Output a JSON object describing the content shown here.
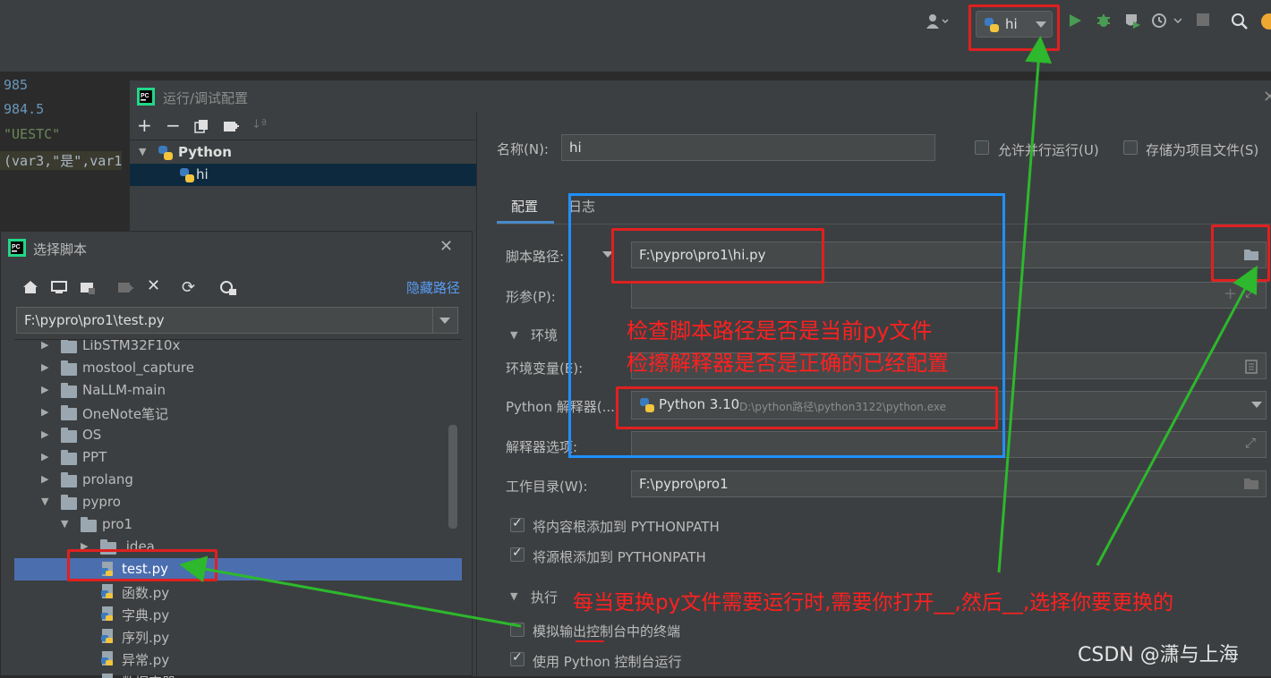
{
  "toolbar": {
    "run_config_name": "hi"
  },
  "editor": {
    "lines": [
      "985",
      "984.5",
      "\"UESTC\"",
      "(var3,\"是\",var1"
    ]
  },
  "run_debug_dialog": {
    "title": "运行/调试配置",
    "tree": {
      "group": "Python",
      "item": "hi"
    },
    "name_label": "名称(N):",
    "name_value": "hi",
    "allow_parallel_label": "允许并行运行(U)",
    "store_as_project_file_label": "存储为项目文件(S)",
    "tabs": [
      "配置",
      "日志"
    ],
    "script_path_label": "脚本路径:",
    "script_path_value": "F:\\pypro\\pro1\\hi.py",
    "params_label": "形参(P):",
    "env_section": "环境",
    "env_vars_label": "环境变量(E):",
    "interpreter_label": "Python 解释器(...",
    "interpreter_name": "Python 3.10",
    "interpreter_path": "D:\\python路径\\python3122\\python.exe",
    "interpreter_options_label": "解释器选项:",
    "workdir_label": "工作目录(W):",
    "workdir_value": "F:\\pypro\\pro1",
    "add_content_roots_label": "将内容根添加到 PYTHONPATH",
    "add_source_roots_label": "将源根添加到 PYTHONPATH",
    "exec_section": "执行",
    "emulate_terminal_label": "模拟输出控制台中的终端",
    "use_python_console_label": "使用 Python 控制台运行"
  },
  "choose_script_dialog": {
    "title": "选择脚本",
    "hide_path_label": "隐藏路径",
    "path_value": "F:\\pypro\\pro1\\test.py",
    "tree": [
      {
        "label": "LibSTM32F10x",
        "type": "folder",
        "indent": 0,
        "expanded": false
      },
      {
        "label": "mostool_capture",
        "type": "folder",
        "indent": 0,
        "expanded": false
      },
      {
        "label": "NaLLM-main",
        "type": "folder",
        "indent": 0,
        "expanded": false
      },
      {
        "label": "OneNote笔记",
        "type": "folder",
        "indent": 0,
        "expanded": false
      },
      {
        "label": "OS",
        "type": "folder",
        "indent": 0,
        "expanded": false
      },
      {
        "label": "PPT",
        "type": "folder",
        "indent": 0,
        "expanded": false
      },
      {
        "label": "prolang",
        "type": "folder",
        "indent": 0,
        "expanded": false
      },
      {
        "label": "pypro",
        "type": "folder",
        "indent": 0,
        "expanded": true
      },
      {
        "label": "pro1",
        "type": "folder",
        "indent": 1,
        "expanded": true
      },
      {
        "label": ".idea",
        "type": "folder",
        "indent": 2,
        "expanded": false
      },
      {
        "label": "test.py",
        "type": "py",
        "indent": 2,
        "selected": true
      },
      {
        "label": "函数.py",
        "type": "py",
        "indent": 2
      },
      {
        "label": "字典.py",
        "type": "py",
        "indent": 2
      },
      {
        "label": "序列.py",
        "type": "py",
        "indent": 2
      },
      {
        "label": "异常.py",
        "type": "py",
        "indent": 2
      },
      {
        "label": "数据容器.py",
        "type": "py",
        "indent": 2
      }
    ]
  },
  "annotations": {
    "note_line1": "检查脚本路径是否是当前py文件",
    "note_line2": "检擦解释器是否是正确的已经配置",
    "note_bottom": "每当更换py文件需要运行时,需要你打开__,然后__,选择你要更换的"
  },
  "watermark": "CSDN @潇与上海",
  "colors": {
    "annotation_red": "#e02020",
    "annotation_blue": "#1e90ff",
    "annotation_green": "#2db82d",
    "selection": "#4b6eaf"
  }
}
